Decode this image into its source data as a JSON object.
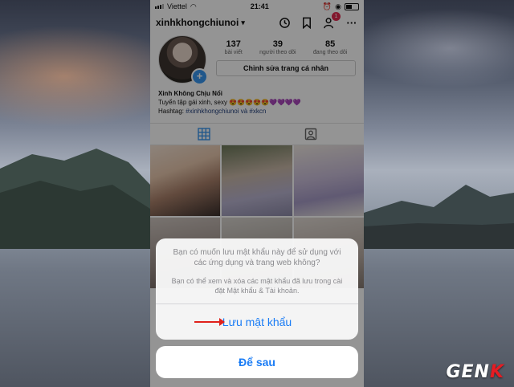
{
  "status_bar": {
    "carrier": "Viettel",
    "time": "21:41"
  },
  "profile": {
    "username": "xinhkhongchiunoi",
    "activity_badge": "1",
    "stats": [
      {
        "value": "137",
        "label": "bài viết"
      },
      {
        "value": "39",
        "label": "người theo dõi"
      },
      {
        "value": "85",
        "label": "đang theo dõi"
      }
    ],
    "edit_button": "Chỉnh sửa trang cá nhân",
    "display_name": "Xinh Không Chịu Nổi",
    "bio_line1": "Tuyển tập gái xinh, sexy 😍😍😍😍😍💜💜💜💜",
    "bio_line2_prefix": "Hashtag: ",
    "bio_line2_tags": "#xinhkhongchiunoi và #xkcn"
  },
  "dialog": {
    "question": "Bạn có muốn lưu mật khẩu này để sử dụng với các ứng dụng và trang web không?",
    "subtitle": "Bạn có thể xem và xóa các mật khẩu đã lưu trong cài đặt Mật khẩu & Tài khoản.",
    "save_label": "Lưu mật khẩu",
    "later_label": "Để sau"
  },
  "watermark": {
    "main": "GEN",
    "accent": "K"
  },
  "colors": {
    "ios_blue": "#1a7cf5",
    "ig_blue": "#3897f0",
    "arrow_red": "#e0211b",
    "badge_red": "#e2294f"
  },
  "grid_photos": [
    "photo-1",
    "photo-2",
    "photo-3",
    "photo-4",
    "photo-5",
    "photo-6"
  ]
}
